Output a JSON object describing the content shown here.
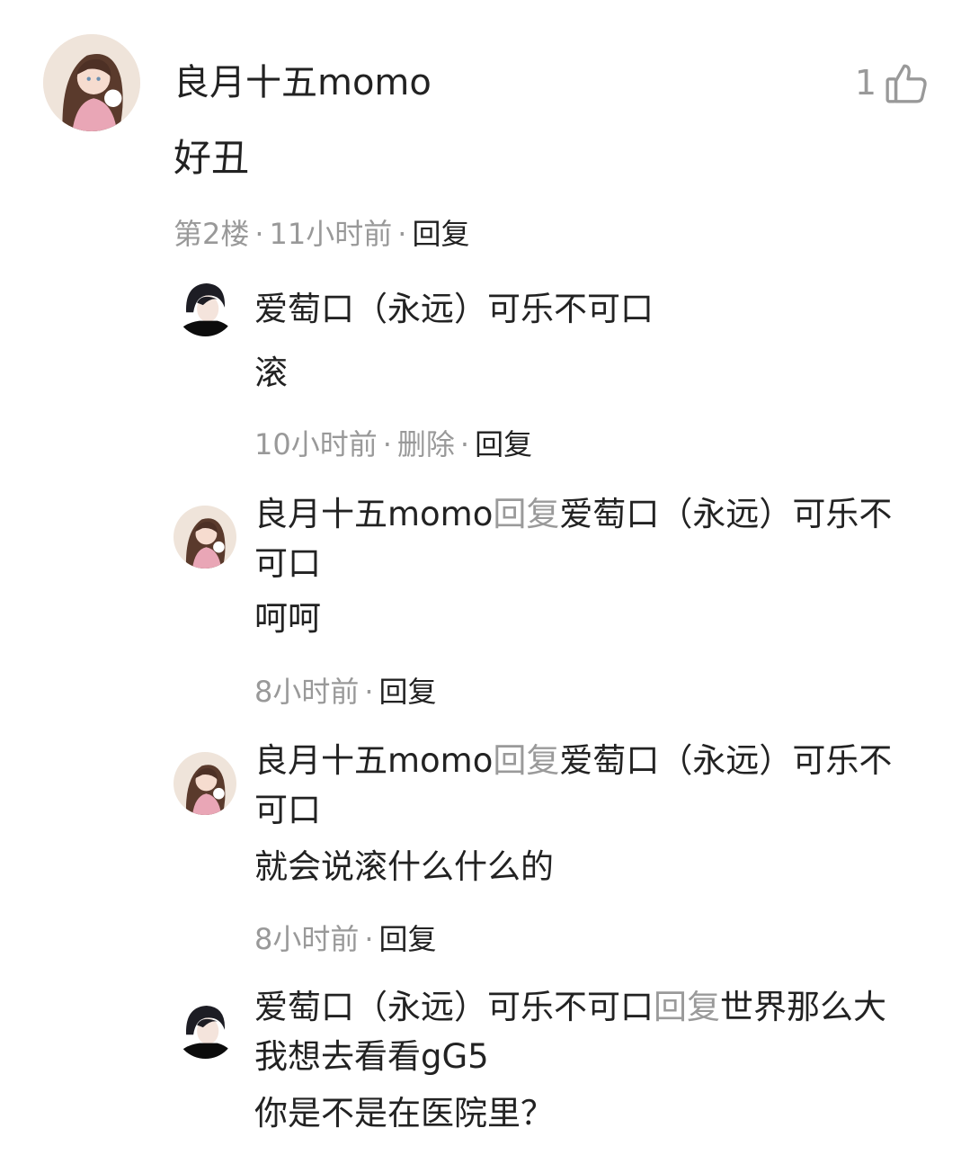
{
  "main_comment": {
    "author": "良月十五momo",
    "text": "好丑",
    "floor": "第2楼",
    "time": "11小时前",
    "reply_label": "回复",
    "like_count": "1",
    "like_icon": "thumbs-up-icon"
  },
  "replies": [
    {
      "author": "爱萄口（永远）可乐不可口",
      "text": "滚",
      "time": "10小时前",
      "delete_label": "删除",
      "reply_label": "回复"
    },
    {
      "author": "良月十五momo",
      "connector": "回复",
      "target": "爱萄口（永远）可乐不可口",
      "text": "呵呵",
      "time": "8小时前",
      "reply_label": "回复"
    },
    {
      "author": "良月十五momo",
      "connector": "回复",
      "target": "爱萄口（永远）可乐不可口",
      "text": "就会说滚什么什么的",
      "time": "8小时前",
      "reply_label": "回复"
    },
    {
      "author": "爱萄口（永远）可乐不可口",
      "connector": "回复",
      "target": "世界那么大我想去看看gG5",
      "text": "你是不是在医院里？"
    }
  ],
  "separator": "·"
}
